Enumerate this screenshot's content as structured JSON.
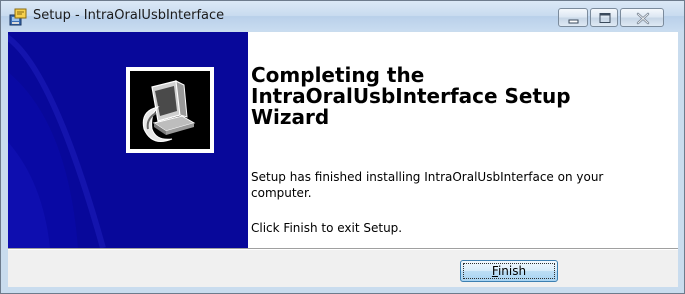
{
  "window": {
    "title": "Setup - IntraOralUsbInterface",
    "icon": "setup-installer-icon",
    "controls": [
      "minimize-icon",
      "maximize-icon",
      "close-icon"
    ]
  },
  "wizard": {
    "heading_lines": [
      "Completing the",
      "IntraOralUsbInterface Setup",
      "Wizard"
    ],
    "body_line_1": "Setup has finished installing IntraOralUsbInterface on your",
    "body_line_2": "computer.",
    "body_line_3": "Click Finish to exit Setup.",
    "image_icon": "computer-install-icon"
  },
  "footer": {
    "finish_mnemonic": "F",
    "finish_rest": "inish"
  },
  "colors": {
    "banner": "#08089a",
    "titlebar": "#c8dbef",
    "footer": "#f0f0f0"
  }
}
